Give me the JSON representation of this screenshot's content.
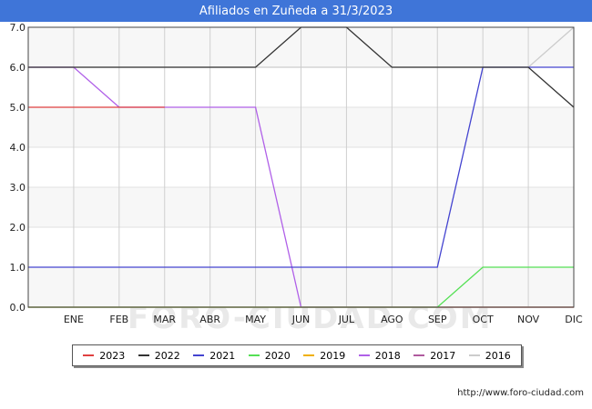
{
  "chart_data": {
    "type": "line",
    "title": "Afiliados en Zuñeda a 31/3/2023",
    "categories": [
      "",
      "ENE",
      "FEB",
      "MAR",
      "ABR",
      "MAY",
      "JUN",
      "JUL",
      "AGO",
      "SEP",
      "OCT",
      "NOV",
      "DIC"
    ],
    "ylim": [
      0,
      7
    ],
    "yticks": [
      "0.0",
      "1.0",
      "2.0",
      "3.0",
      "4.0",
      "5.0",
      "6.0",
      "7.0"
    ],
    "grid": true,
    "legend_position": "bottom",
    "series": [
      {
        "name": "2016",
        "color": "#cccccc",
        "values": [
          6,
          6,
          6,
          6,
          6,
          6,
          6,
          6,
          6,
          6,
          6,
          6,
          7
        ]
      },
      {
        "name": "2017",
        "color": "#b05a9e",
        "values": [
          0,
          0,
          0,
          0,
          0,
          0,
          0,
          0,
          0,
          0,
          0,
          0,
          0
        ]
      },
      {
        "name": "2018",
        "color": "#b060e8",
        "values": [
          6,
          6,
          5,
          5,
          5,
          5,
          0,
          0,
          0,
          0,
          0,
          0,
          0
        ]
      },
      {
        "name": "2019",
        "color": "#f0b000",
        "values": [
          0,
          0,
          0,
          0,
          0,
          0,
          0,
          0,
          0,
          0,
          0,
          0,
          0
        ]
      },
      {
        "name": "2020",
        "color": "#55e055",
        "values": [
          0,
          0,
          0,
          0,
          0,
          0,
          0,
          0,
          0,
          0,
          1,
          1,
          1
        ]
      },
      {
        "name": "2021",
        "color": "#4444d0",
        "values": [
          1,
          1,
          1,
          1,
          1,
          1,
          1,
          1,
          1,
          1,
          6,
          6,
          6
        ]
      },
      {
        "name": "2022",
        "color": "#333333",
        "values": [
          6,
          6,
          6,
          6,
          6,
          6,
          7,
          7,
          6,
          6,
          6,
          6,
          5
        ]
      },
      {
        "name": "2023",
        "color": "#e04040",
        "values": [
          5,
          5,
          5,
          5
        ]
      }
    ]
  },
  "legend": [
    {
      "label": "2023",
      "color": "#e04040"
    },
    {
      "label": "2022",
      "color": "#333333"
    },
    {
      "label": "2021",
      "color": "#4444d0"
    },
    {
      "label": "2020",
      "color": "#55e055"
    },
    {
      "label": "2019",
      "color": "#f0b000"
    },
    {
      "label": "2018",
      "color": "#b060e8"
    },
    {
      "label": "2017",
      "color": "#b05a9e"
    },
    {
      "label": "2016",
      "color": "#cccccc"
    }
  ],
  "source_text": "http://www.foro-ciudad.com",
  "watermark_text": "FORO-CIUDAD.COM"
}
